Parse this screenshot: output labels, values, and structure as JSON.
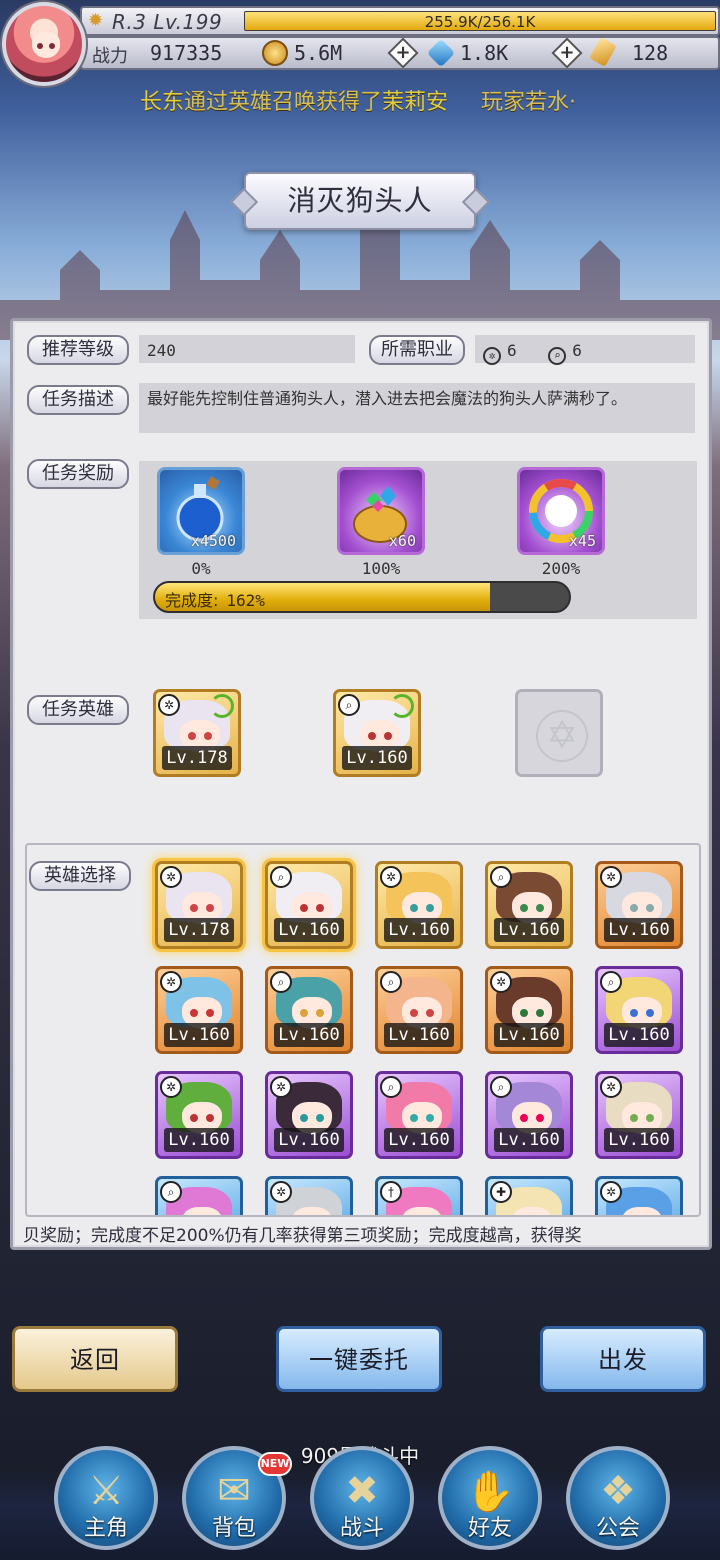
{
  "player": {
    "rank_level": "R.3 Lv.199",
    "exp_text": "255.9K/256.1K",
    "exp_fraction": 0.999,
    "power_label": "战力",
    "power_value": "917335",
    "resources": [
      {
        "icon": "gold-coin-icon",
        "value": "5.6M",
        "color": "#d8a23a"
      },
      {
        "icon": "diamond-icon",
        "value": "1.8K",
        "color": "#2e8fd6"
      },
      {
        "icon": "ticket-icon",
        "value": "128",
        "color": "#e0a536"
      }
    ]
  },
  "ticker": {
    "name": "长东",
    "text1": "通过英雄召唤获得了",
    "hero": "茉莉安",
    "text2": "玩家若水·"
  },
  "quest": {
    "title": "消灭狗头人",
    "recommended_level_label": "推荐等级",
    "recommended_level": "240",
    "required_class_label": "所需职业",
    "required_class": [
      {
        "icon": "shuriken-icon",
        "count": "6"
      },
      {
        "icon": "magnifier-icon",
        "count": "6"
      }
    ],
    "description_label": "任务描述",
    "description": "最好能先控制住普通狗头人，潜入进去把会魔法的狗头人萨满秒了。",
    "reward_label": "任务奖励",
    "rewards": [
      {
        "icon": "potion-bottle-icon",
        "qty": "x4500",
        "pct": "0%"
      },
      {
        "icon": "gem-bag-icon",
        "qty": "x60",
        "pct": "100%"
      },
      {
        "icon": "prism-medal-icon",
        "qty": "x45",
        "pct": "200%"
      }
    ],
    "completion_label": "完成度:",
    "completion_value": "162%",
    "completion_fraction": 0.81,
    "heroes_label": "任务英雄",
    "quest_heroes": [
      {
        "level": "Lv.178",
        "class_icon": "shuriken-icon"
      },
      {
        "level": "Lv.160",
        "class_icon": "magnifier-icon"
      }
    ],
    "select_label": "英雄选择",
    "hero_list": [
      {
        "level": "Lv.178",
        "class_icon": "shuriken-icon",
        "frame": "gold",
        "hair": "#e9e4ef",
        "eyes": "#c44",
        "selected": true
      },
      {
        "level": "Lv.160",
        "class_icon": "magnifier-icon",
        "frame": "gold",
        "hair": "#f0eef3",
        "eyes": "#b33",
        "selected": true
      },
      {
        "level": "Lv.160",
        "class_icon": "shuriken-icon",
        "frame": "gold",
        "hair": "#f4c35a",
        "eyes": "#3a9c9c",
        "selected": false
      },
      {
        "level": "Lv.160",
        "class_icon": "magnifier-icon",
        "frame": "gold",
        "hair": "#7a4b32",
        "eyes": "#3c8a4c",
        "selected": false
      },
      {
        "level": "Lv.160",
        "class_icon": "shuriken-icon",
        "frame": "orange",
        "hair": "#d8d8e0",
        "eyes": "#8aa",
        "selected": false
      },
      {
        "level": "Lv.160",
        "class_icon": "shuriken-icon",
        "frame": "orange",
        "hair": "#7fc2e8",
        "eyes": "#c33",
        "selected": false
      },
      {
        "level": "Lv.160",
        "class_icon": "magnifier-icon",
        "frame": "orange",
        "hair": "#4aa1a8",
        "eyes": "#d9a43a",
        "selected": false
      },
      {
        "level": "Lv.160",
        "class_icon": "magnifier-icon",
        "frame": "orange",
        "hair": "#f4b58c",
        "eyes": "#c44",
        "selected": false
      },
      {
        "level": "Lv.160",
        "class_icon": "shuriken-icon",
        "frame": "orange",
        "hair": "#6a3a2a",
        "eyes": "#2d7a3a",
        "selected": false
      },
      {
        "level": "Lv.160",
        "class_icon": "magnifier-icon",
        "frame": "purple",
        "hair": "#f2d676",
        "eyes": "#3b6fd6",
        "selected": false
      },
      {
        "level": "Lv.160",
        "class_icon": "shuriken-icon",
        "frame": "purple",
        "hair": "#5fae3e",
        "eyes": "#b33",
        "selected": false
      },
      {
        "level": "Lv.160",
        "class_icon": "shuriken-icon",
        "frame": "purple",
        "hair": "#3a2a3a",
        "eyes": "#2a9a9a",
        "selected": false
      },
      {
        "level": "Lv.160",
        "class_icon": "magnifier-icon",
        "frame": "purple",
        "hair": "#f27aa8",
        "eyes": "#3aa",
        "selected": false
      },
      {
        "level": "Lv.160",
        "class_icon": "magnifier-icon",
        "frame": "purple",
        "hair": "#a487d6",
        "eyes": "#e05",
        "selected": false
      },
      {
        "level": "Lv.160",
        "class_icon": "shuriken-icon",
        "frame": "purple",
        "hair": "#e8dcc2",
        "eyes": "#7a5",
        "selected": false
      },
      {
        "level": "",
        "class_icon": "magnifier-icon",
        "frame": "blue",
        "hair": "#e078d6",
        "eyes": "#b3c",
        "selected": false
      },
      {
        "level": "",
        "class_icon": "shuriken-icon",
        "frame": "blue",
        "hair": "#cfd2d6",
        "eyes": "#555",
        "selected": false
      },
      {
        "level": "",
        "class_icon": "dagger-icon",
        "frame": "blue",
        "hair": "#f07ac2",
        "eyes": "#c3c",
        "selected": false
      },
      {
        "level": "",
        "class_icon": "cross-icon",
        "frame": "blue",
        "hair": "#f4e4b4",
        "eyes": "#6a5",
        "selected": false
      },
      {
        "level": "",
        "class_icon": "shuriken-icon",
        "frame": "blue",
        "hair": "#5aa0e6",
        "eyes": "#36c",
        "selected": false
      }
    ],
    "note": "贝奖励；完成度不足200%仍有几率获得第三项奖励；完成度越高，获得奖"
  },
  "buttons": {
    "back": "返回",
    "delegate": "一键委托",
    "depart": "出发"
  },
  "status_text": "909层战斗中",
  "nav": [
    {
      "label": "主角",
      "icon": "helmet-icon",
      "glyph": "⚔"
    },
    {
      "label": "背包",
      "icon": "backpack-icon",
      "glyph": "✉",
      "badge": "NEW"
    },
    {
      "label": "战斗",
      "icon": "crossed-swords-icon",
      "glyph": "✖"
    },
    {
      "label": "好友",
      "icon": "handshake-icon",
      "glyph": "✋"
    },
    {
      "label": "公会",
      "icon": "guild-crest-icon",
      "glyph": "❖"
    }
  ],
  "colors": {
    "accent_gold": "#e1ae0c",
    "panel_bg": "#ececee",
    "button_blue": "#84b8ec"
  }
}
